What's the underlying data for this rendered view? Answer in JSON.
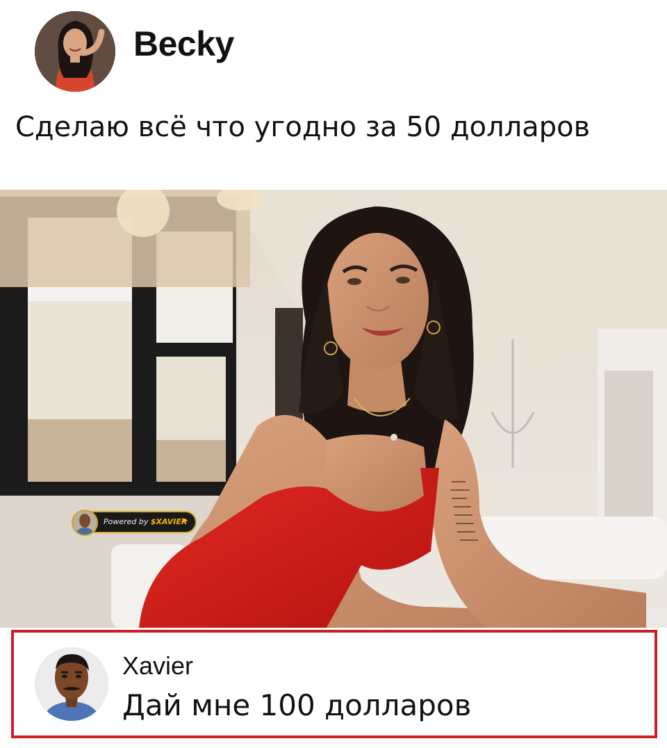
{
  "post": {
    "author": "Becky",
    "text": "Сделаю всё что угодно за 50 долларов",
    "avatar_icon": "woman-avatar"
  },
  "photo": {
    "description_icon": "woman-red-dress-photo"
  },
  "watermark": {
    "prefix": "Powered by",
    "brand": "$XAVIER",
    "icon": "rocket-icon",
    "brand_color": "#f2b500"
  },
  "reply": {
    "author": "Xavier",
    "text": "Дай мне 100 долларов",
    "avatar_icon": "man-avatar",
    "border_color": "#cc1e24"
  }
}
